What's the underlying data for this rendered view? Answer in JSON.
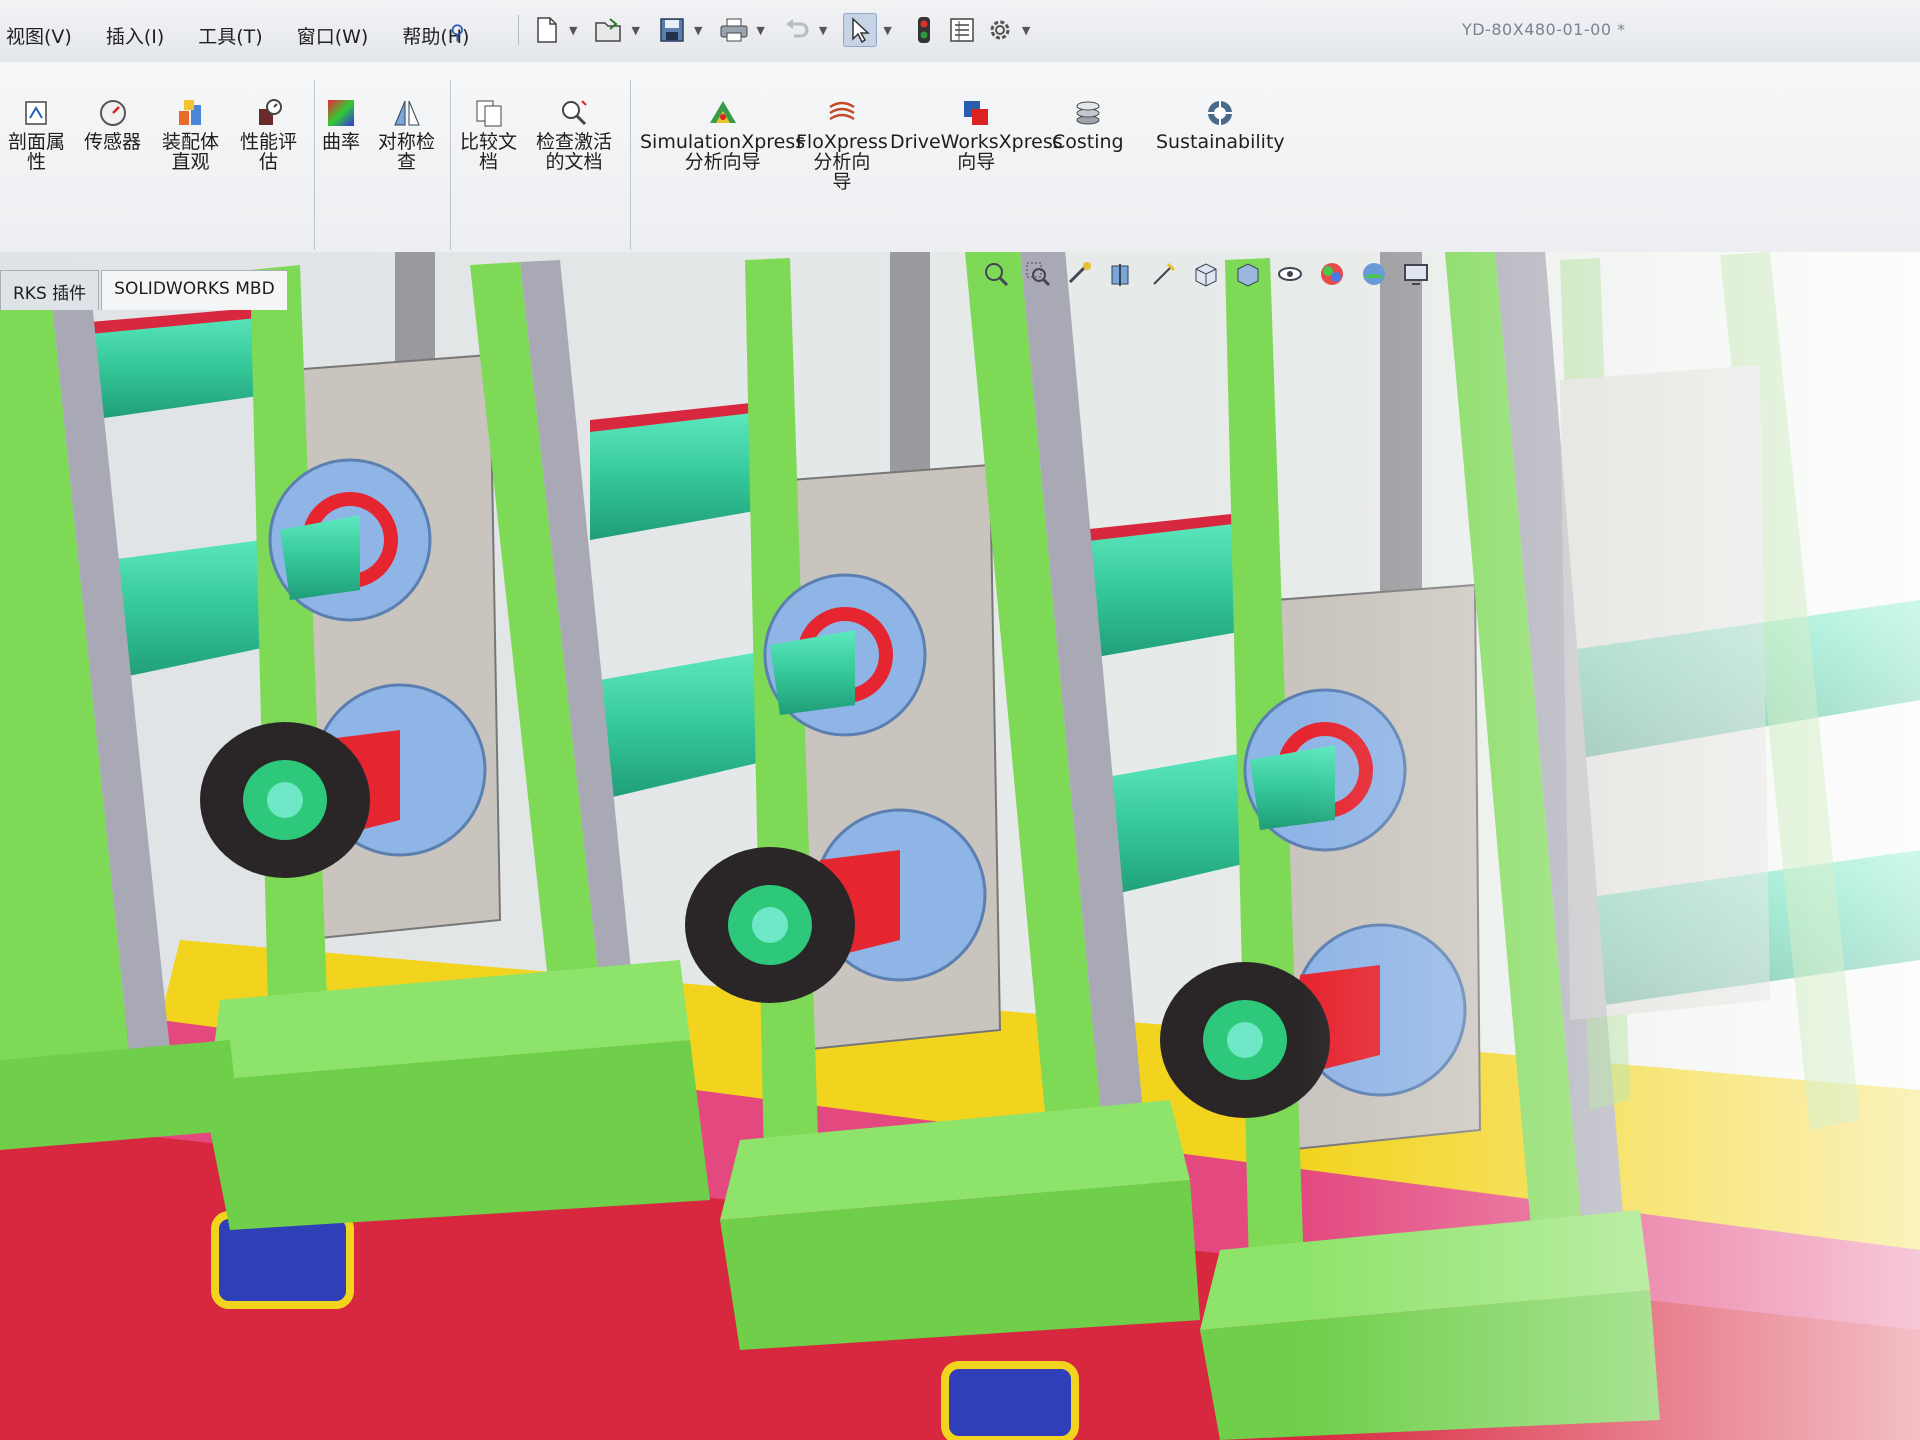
{
  "window": {
    "document_title": "YD-80X480-01-00 *"
  },
  "menu": {
    "items": [
      {
        "label": "视图(V)"
      },
      {
        "label": "插入(I)"
      },
      {
        "label": "工具(T)"
      },
      {
        "label": "窗口(W)"
      },
      {
        "label": "帮助(H)"
      }
    ]
  },
  "quick_access": {
    "icons": [
      "new-document-icon",
      "open-folder-icon",
      "save-icon",
      "print-icon",
      "undo-icon",
      "select-pointer-icon",
      "rebuild-traffic-light-icon",
      "file-properties-icon",
      "options-gear-icon"
    ]
  },
  "command_manager": {
    "commands": [
      {
        "label": "剖面属\n性",
        "icon": "section-properties-icon"
      },
      {
        "label": "传感器",
        "icon": "sensor-icon"
      },
      {
        "label": "装配体\n直观",
        "icon": "assembly-visualization-icon"
      },
      {
        "label": "性能评\n估",
        "icon": "performance-evaluation-icon"
      },
      {
        "label": "曲率",
        "icon": "curvature-icon"
      },
      {
        "label": "对称检\n查",
        "icon": "symmetry-check-icon"
      },
      {
        "label": "比较文\n档",
        "icon": "compare-documents-icon"
      },
      {
        "label": "检查激活\n的文档",
        "icon": "check-active-document-icon"
      },
      {
        "label": "SimulationXpress\n分析向导",
        "icon": "simulationxpress-icon"
      },
      {
        "label": "FloXpress\n分析向\n导",
        "icon": "floxpress-icon"
      },
      {
        "label": "DriveWorksXpress\n向导",
        "icon": "driveworksxpress-icon"
      },
      {
        "label": "Costing",
        "icon": "costing-icon"
      },
      {
        "label": "Sustainability",
        "icon": "sustainability-icon"
      }
    ]
  },
  "tabs": [
    {
      "label": "RKS 插件"
    },
    {
      "label": "SOLIDWORKS MBD"
    }
  ],
  "heads_up_toolbar": {
    "icons": [
      "zoom-to-fit-icon",
      "zoom-to-area-icon",
      "previous-view-icon",
      "section-view-icon",
      "dynamic-annotation-icon",
      "view-orientation-icon",
      "display-style-icon",
      "hide-show-items-icon",
      "edit-appearance-icon",
      "apply-scene-icon",
      "view-settings-icon"
    ]
  },
  "colors": {
    "frame_green": "#7ed957",
    "frame_gray": "#a9a9b5",
    "shaft_teal": "#3fd3a6",
    "base_red": "#d8283f",
    "bed_yellow": "#f2d41f",
    "bed_magenta": "#e3487f",
    "bearing_blue": "#8fb4e6",
    "bearing_plate": "#c9c4bd",
    "coupling_black": "#2a2628",
    "accent_red": "#e5252f"
  }
}
